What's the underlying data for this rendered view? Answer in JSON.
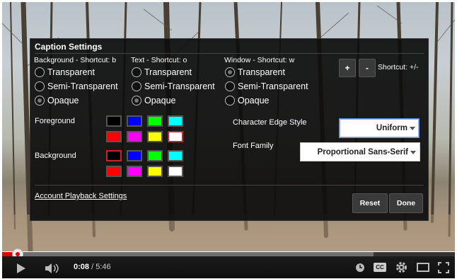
{
  "dialog": {
    "title": "Caption Settings",
    "background_group": {
      "heading": "Background - Shortcut: b",
      "options": [
        "Transparent",
        "Semi-Transparent",
        "Opaque"
      ],
      "selected": "Opaque"
    },
    "text_group": {
      "heading": "Text - Shortcut: o",
      "options": [
        "Transparent",
        "Semi-Transparent",
        "Opaque"
      ],
      "selected": "Opaque"
    },
    "window_group": {
      "heading": "Window - Shortcut: w",
      "options": [
        "Transparent",
        "Semi-Transparent",
        "Opaque"
      ],
      "selected": "Transparent"
    },
    "size_plus_label": "+",
    "size_minus_label": "-",
    "size_shortcut": "Shortcut: +/-",
    "foreground_label": "Foreground",
    "background_label": "Background",
    "foreground_colors": [
      "#000000",
      "#0000ff",
      "#00ff00",
      "#00ffff",
      "#ff0000",
      "#ff00ff",
      "#ffff00",
      "#ffffff"
    ],
    "foreground_selected": "#ffffff",
    "background_colors": [
      "#000000",
      "#0000ff",
      "#00ff00",
      "#00ffff",
      "#ff0000",
      "#ff00ff",
      "#ffff00",
      "#ffffff"
    ],
    "background_selected": "#000000",
    "edge_style_label": "Character Edge Style",
    "edge_style_value": "Uniform",
    "font_family_label": "Font Family",
    "font_family_value": "Proportional Sans-Serif",
    "account_link": "Account Playback Settings",
    "reset_label": "Reset",
    "done_label": "Done"
  },
  "player": {
    "time_current": "0:08",
    "time_separator": " / ",
    "time_total": "5:46",
    "played_fraction": 0.023,
    "buffered_fraction": 0.82,
    "icons": [
      "play-icon",
      "volume-icon",
      "watch-later-icon",
      "cc-icon",
      "settings-icon",
      "theater-mode-icon",
      "fullscreen-icon"
    ],
    "cc_label": "CC"
  }
}
